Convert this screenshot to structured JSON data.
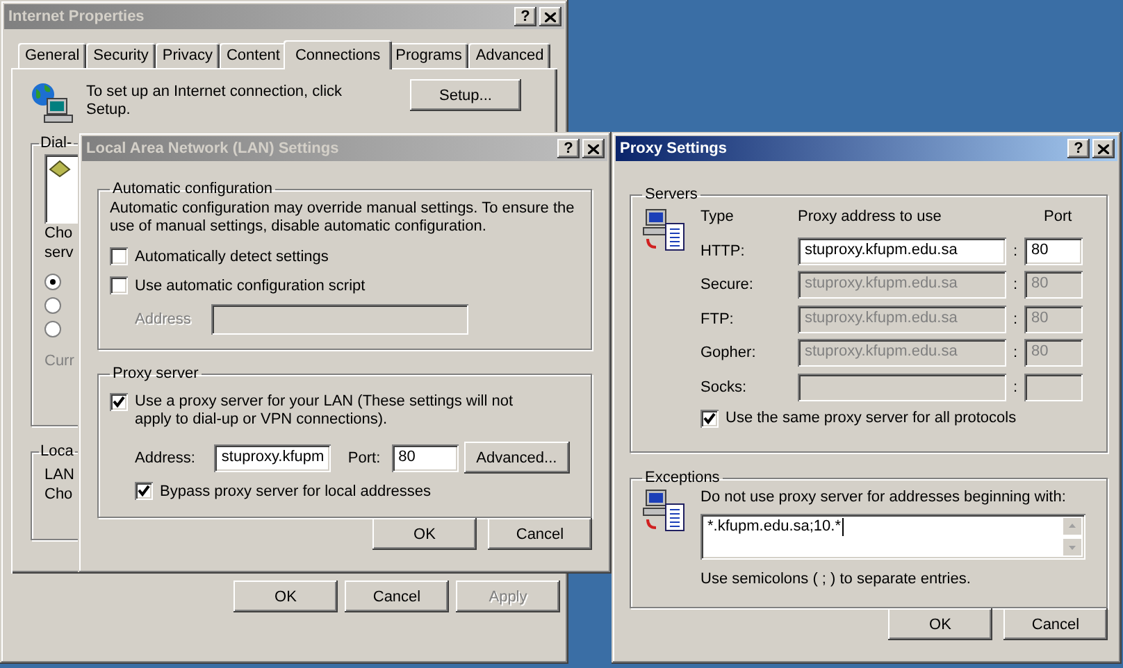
{
  "internet_properties": {
    "title": "Internet Properties",
    "active": false,
    "help": "?",
    "tabs": [
      {
        "label": "General",
        "selected": false
      },
      {
        "label": "Security",
        "selected": false
      },
      {
        "label": "Privacy",
        "selected": false
      },
      {
        "label": "Content",
        "selected": false
      },
      {
        "label": "Connections",
        "selected": true
      },
      {
        "label": "Programs",
        "selected": false
      },
      {
        "label": "Advanced",
        "selected": false
      }
    ],
    "setup_text": "To set up an Internet connection, click Setup.",
    "setup_button": "Setup...",
    "dialup_group": {
      "legend": "Dial-",
      "text_1": "Cho",
      "text_2": "serv",
      "radios": [
        {
          "selected": true
        },
        {
          "selected": false
        },
        {
          "selected": false
        }
      ],
      "text_3": "Curr"
    },
    "lan_group": {
      "legend": "Loca",
      "lines": [
        "LAN",
        "Cho"
      ]
    },
    "buttons": [
      {
        "label": "OK",
        "disabled": false
      },
      {
        "label": "Cancel",
        "disabled": false
      },
      {
        "label": "Apply",
        "disabled": true
      }
    ]
  },
  "lan_settings": {
    "title": "Local Area Network (LAN) Settings",
    "active": false,
    "help": "?",
    "auto_config": {
      "legend": "Automatic configuration",
      "description": "Automatic configuration may override manual settings.  To ensure the use of manual settings, disable automatic configuration.",
      "options": [
        {
          "label": "Automatically detect settings",
          "checked": false
        },
        {
          "label": "Use automatic configuration script",
          "checked": false
        }
      ],
      "address_label": "Address",
      "address_disabled": true
    },
    "proxy_server": {
      "legend": "Proxy server",
      "use_proxy": {
        "label": "Use a proxy server for your LAN (These settings will not apply to dial-up or VPN connections).",
        "checked": true
      },
      "address_label": "Address:",
      "address_value": "stuproxy.kfupm",
      "port_label": "Port:",
      "port_value": "80",
      "advanced_button": "Advanced...",
      "bypass": {
        "label": "Bypass proxy server for local addresses",
        "checked": true
      }
    },
    "buttons": [
      "OK",
      "Cancel"
    ]
  },
  "proxy_settings": {
    "title": "Proxy Settings",
    "active": true,
    "help": "?",
    "servers": {
      "legend": "Servers",
      "headers": [
        "Type",
        "Proxy address to use",
        "Port"
      ],
      "rows": [
        {
          "type": "HTTP:",
          "address": "stuproxy.kfupm.edu.sa",
          "separator": ":",
          "port": "80",
          "disabled": false
        },
        {
          "type": "Secure:",
          "address": "stuproxy.kfupm.edu.sa",
          "separator": ":",
          "port": "80",
          "disabled": true
        },
        {
          "type": "FTP:",
          "address": "stuproxy.kfupm.edu.sa",
          "separator": ":",
          "port": "80",
          "disabled": true
        },
        {
          "type": "Gopher:",
          "address": "stuproxy.kfupm.edu.sa",
          "separator": ":",
          "port": "80",
          "disabled": true
        },
        {
          "type": "Socks:",
          "separator": ":",
          "disabled": true
        }
      ],
      "same_for_all": {
        "label": "Use the same proxy server for all protocols",
        "checked": true
      }
    },
    "exceptions": {
      "legend": "Exceptions",
      "label": "Do not use proxy server for addresses beginning with:",
      "value": "*.kfupm.edu.sa;10.*",
      "note": "Use semicolons ( ; ) to separate entries."
    },
    "buttons": [
      "OK",
      "Cancel"
    ]
  }
}
